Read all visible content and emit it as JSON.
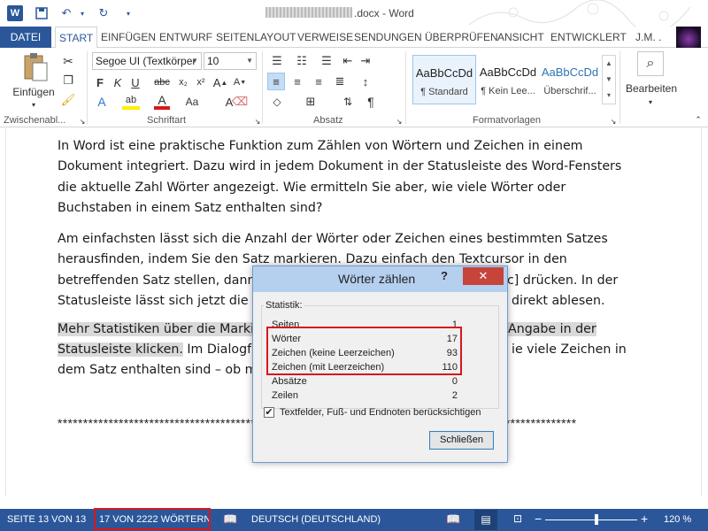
{
  "window": {
    "title": ".docx - Word",
    "app_icon": "W",
    "buttons": {
      "help": "?",
      "restore": "▭",
      "minimize": "—"
    }
  },
  "ribbon_tabs": [
    "DATEI",
    "START",
    "EINFÜGEN",
    "ENTWURF",
    "SEITENLAYOUT",
    "VERWEISE",
    "SENDUNGEN",
    "ÜBERPRÜFEN",
    "ANSICHT",
    "ENTWICKLERT"
  ],
  "user": "J.M. .",
  "ribbon": {
    "clipboard": {
      "paste": "Einfügen",
      "label": "Zwischenabl..."
    },
    "font": {
      "name": "Segoe UI (Textkörper",
      "size": "10",
      "label": "Schriftart"
    },
    "paragraph": {
      "label": "Absatz"
    },
    "styles": {
      "label": "Formatvorlagen",
      "items": [
        {
          "sample": "AaBbCcDd",
          "name": "¶ Standard"
        },
        {
          "sample": "AaBbCcDd",
          "name": "¶ Kein Lee..."
        },
        {
          "sample": "AaBbCcDd",
          "name": "Überschrif..."
        }
      ]
    },
    "editing": {
      "label": "Bearbeiten"
    }
  },
  "document": {
    "p1": "In Word ist eine praktische Funktion zum Zählen von Wörtern und Zeichen in einem Dokument integriert. Dazu wird in jedem Dokument in der Statusleiste des Word-Fensters die aktuelle Zahl Wörter angezeigt. Wie ermitteln Sie aber, wie viele Wörter oder Buchstaben in einem Satz enthalten sind?",
    "p2_a": "Am einfachsten lässt sich die Anzahl der Wörter oder Zeichen eines bestimmten Satzes herausfinden, indem Sie den Satz markieren. Dazu einfach den Textcursor in den betreffenden Satz stellen, dann",
    "p2_b": "c] drücken. In der",
    "p2_c": "Statusleiste lässt sich jetzt die A",
    "p2_d": "direkt ablesen.",
    "p3_hl_a": "Mehr Statistiken über die Marki",
    "p3_hl_b": "Angabe in der",
    "p3_hl_c": "Statusleiste klicken.",
    "p3_a": " Im Dialogfe",
    "p3_b": "ie viele Zeichen in",
    "p3_c": "dem Satz enthalten sind – ob m",
    "stars": "******************************************************************************************************"
  },
  "dialog": {
    "title": "Wörter zählen",
    "help": "?",
    "close_icon": "✕",
    "group_label": "Statistik:",
    "stats": [
      {
        "label": "Seiten",
        "value": "1"
      },
      {
        "label": "Wörter",
        "value": "17"
      },
      {
        "label": "Zeichen (keine Leerzeichen)",
        "value": "93"
      },
      {
        "label": "Zeichen (mit Leerzeichen)",
        "value": "110"
      },
      {
        "label": "Absätze",
        "value": "0"
      },
      {
        "label": "Zeilen",
        "value": "2"
      }
    ],
    "checkbox_label": "Textfelder, Fuß- und Endnoten berücksichtigen",
    "checkbox_checked": "✔",
    "close_button": "Schließen"
  },
  "status": {
    "page": "SEITE 13 VON 13",
    "words": "17 VON 2222 WÖRTERN",
    "language": "DEUTSCH (DEUTSCHLAND)",
    "zoom": "120 %",
    "zoom_minus": "−",
    "zoom_plus": "+"
  },
  "colors": {
    "accent": "#2b579a",
    "highlight_red": "#d9161c",
    "dialog_title": "#b5cfee"
  }
}
